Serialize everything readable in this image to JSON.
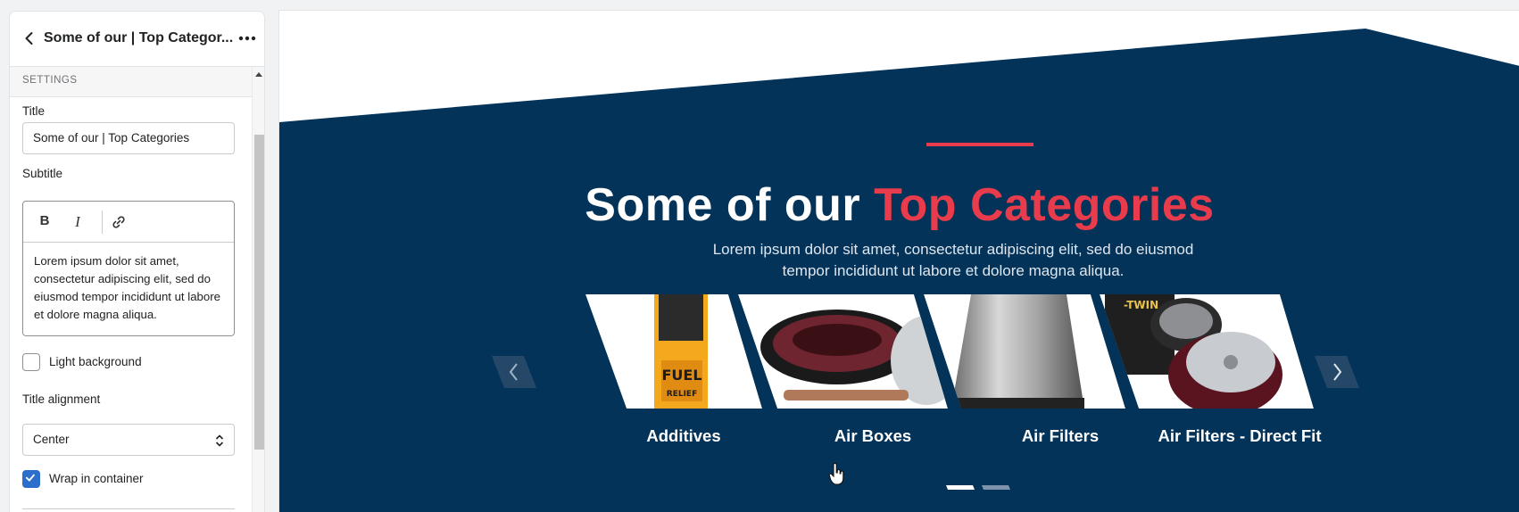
{
  "sidebar": {
    "title": "Some of our | Top Categor...",
    "section_label": "SETTINGS",
    "title_field": {
      "label": "Title",
      "value": "Some of our | Top Categories"
    },
    "subtitle_field": {
      "label": "Subtitle",
      "bold_label": "B",
      "italic_label": "I",
      "value": "Lorem ipsum dolor sit amet, consectetur adipiscing elit, sed do eiusmod tempor incididunt ut labore et dolore magna aliqua."
    },
    "light_background": {
      "label": "Light background",
      "checked": false
    },
    "title_alignment": {
      "label": "Title alignment",
      "value": "Center"
    },
    "wrap_in_container": {
      "label": "Wrap in container",
      "checked": true
    }
  },
  "preview": {
    "title_main": "Some of our",
    "title_accent": "Top Categories",
    "subtitle_line1": "Lorem ipsum dolor sit amet, consectetur adipiscing elit, sed do eiusmod",
    "subtitle_line2": "tempor incididunt ut labore et dolore magna aliqua.",
    "categories": [
      {
        "name": "Additives",
        "image": "fuel-relief-bottle"
      },
      {
        "name": "Air Boxes",
        "image": "oval-air-filter"
      },
      {
        "name": "Air Filters",
        "image": "cone-air-filter"
      },
      {
        "name": "Air Filters - Direct Fit",
        "image": "twin-air-filter-kit"
      }
    ],
    "pagination": {
      "pages": 2,
      "active": 1
    }
  },
  "colors": {
    "navy": "#033359",
    "accent_red": "#e83b4b",
    "checkbox_blue": "#2c6ecb"
  }
}
